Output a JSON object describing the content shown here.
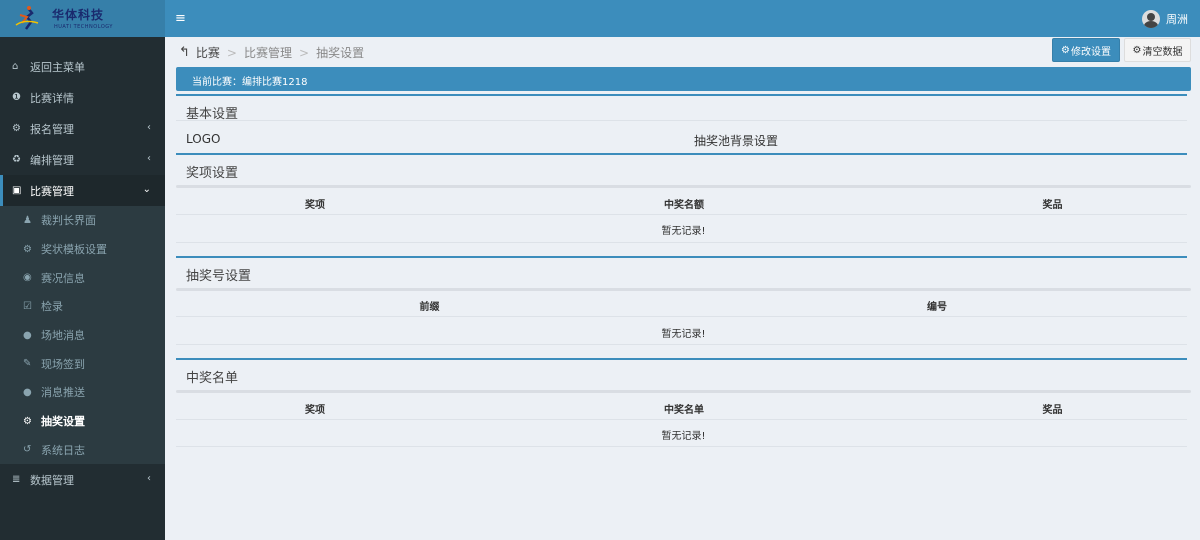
{
  "brand": {
    "name_cn": "华体科技",
    "name_en": "HUATI TECHNOLOGY"
  },
  "sidebar": {
    "items": [
      {
        "label": "返回主菜单",
        "icon": "home-icon"
      },
      {
        "label": "比赛详情",
        "icon": "info-icon"
      },
      {
        "label": "报名管理",
        "icon": "cogs-icon"
      },
      {
        "label": "编排管理",
        "icon": "recycle-icon"
      },
      {
        "label": "比赛管理",
        "icon": "square-icon"
      },
      {
        "label": "数据管理",
        "icon": "database-icon"
      }
    ],
    "subitems": [
      {
        "label": "裁判长界面",
        "icon": "user-icon"
      },
      {
        "label": "奖状模板设置",
        "icon": "gear-icon"
      },
      {
        "label": "赛况信息",
        "icon": "eye-icon"
      },
      {
        "label": "检录",
        "icon": "check-icon"
      },
      {
        "label": "场地消息",
        "icon": "comments-icon"
      },
      {
        "label": "现场签到",
        "icon": "edit-icon"
      },
      {
        "label": "消息推送",
        "icon": "comments-icon"
      },
      {
        "label": "抽奖设置",
        "icon": "gear-icon"
      },
      {
        "label": "系统日志",
        "icon": "history-icon"
      }
    ],
    "active_subitem": "抽奖设置"
  },
  "topbar": {
    "user_name": "周洲"
  },
  "breadcrumb": {
    "back": "比赛",
    "level2": "比赛管理",
    "level3": "抽奖设置",
    "sep": ">"
  },
  "actions": {
    "edit": "修改设置",
    "clear": "清空数据"
  },
  "match_bar": "当前比赛：编排比赛1218",
  "basic": {
    "title": "基本设置",
    "logo_label": "LOGO",
    "bg_label": "抽奖池背景设置"
  },
  "prizes": {
    "title": "奖项设置",
    "columns": [
      "奖项",
      "中奖名额",
      "奖品"
    ],
    "empty": "暂无记录!"
  },
  "numbers": {
    "title": "抽奖号设置",
    "columns": [
      "前缀",
      "编号"
    ],
    "empty": "暂无记录!"
  },
  "winners": {
    "title": "中奖名单",
    "columns": [
      "奖项",
      "中奖名单",
      "奖品"
    ],
    "empty": "暂无记录!"
  },
  "colors": {
    "header": "#3c8dbc",
    "sidebar": "#222d32",
    "content": "#ecf0f5"
  }
}
